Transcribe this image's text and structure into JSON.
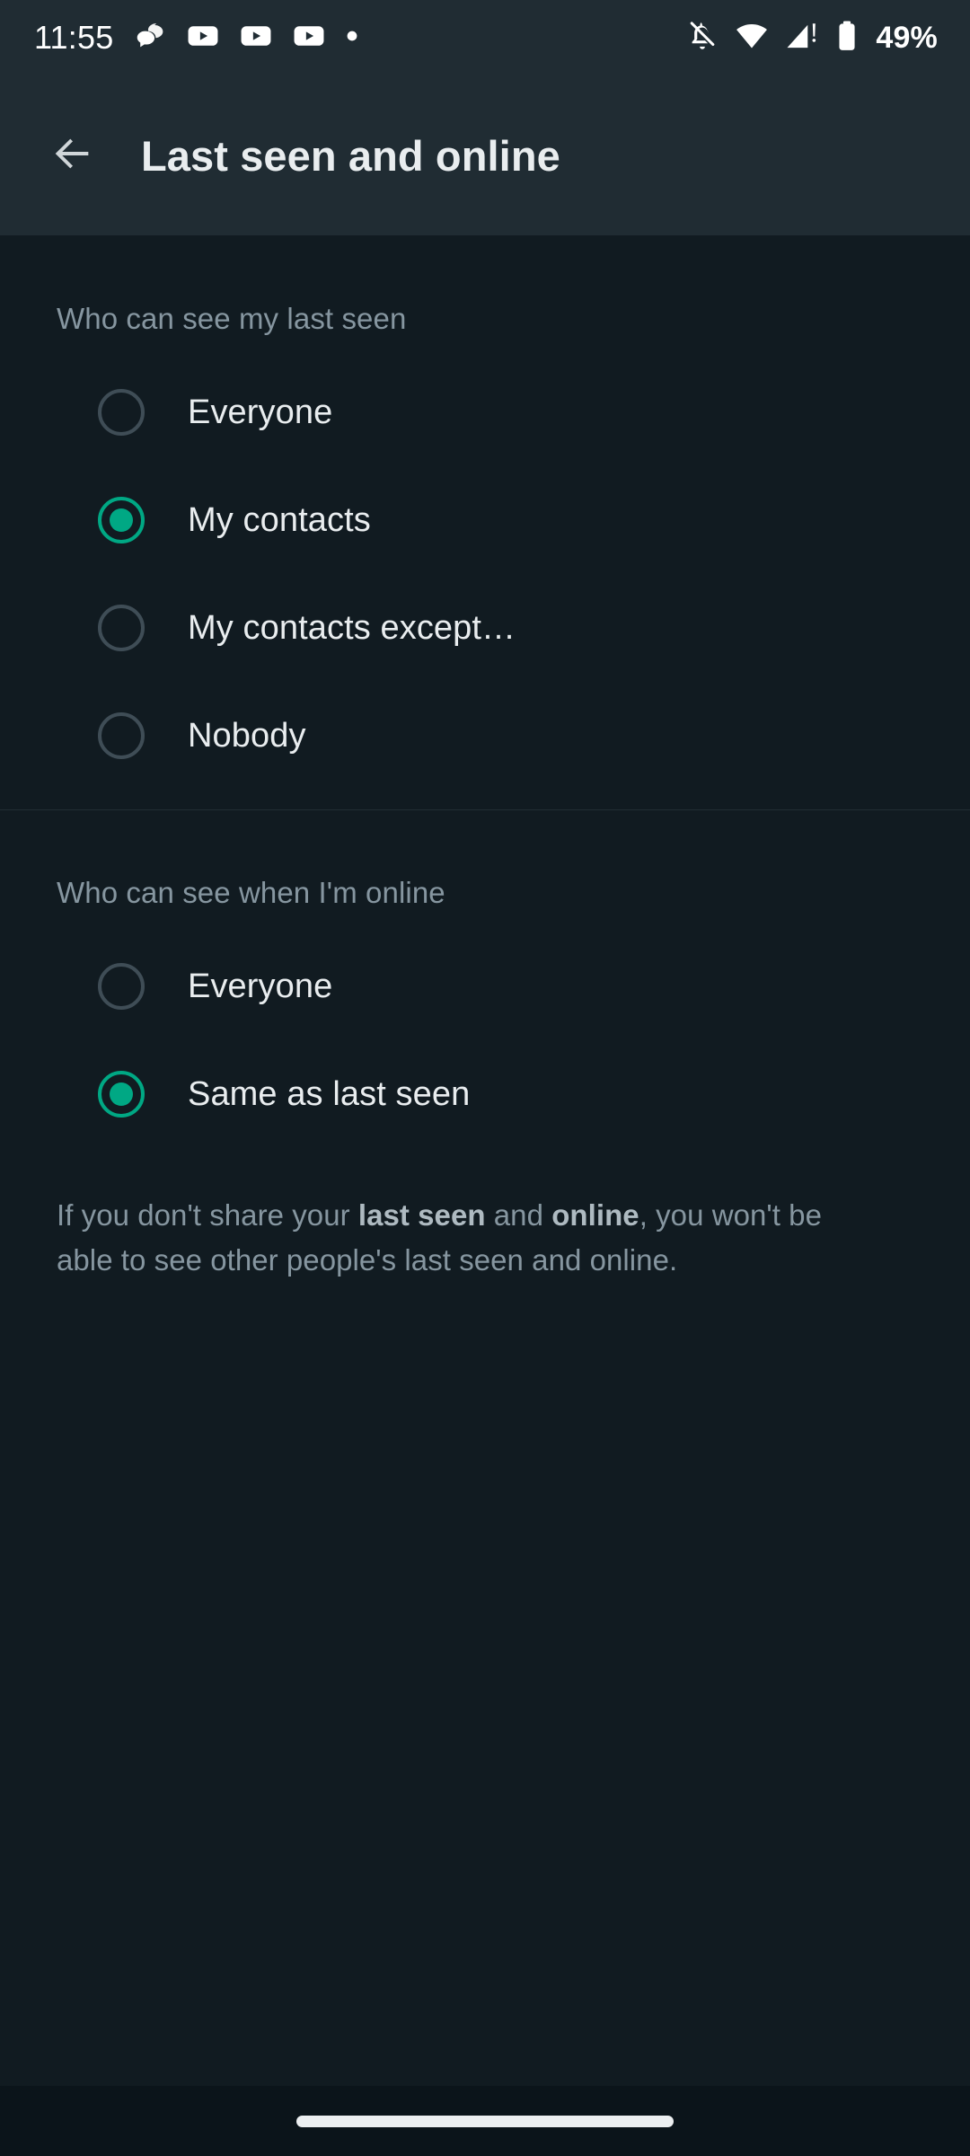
{
  "status_bar": {
    "time": "11:55",
    "left_icons": [
      {
        "name": "chat-bubbles-icon"
      },
      {
        "name": "youtube-play-icon"
      },
      {
        "name": "youtube-play-icon"
      },
      {
        "name": "youtube-play-icon"
      },
      {
        "name": "overflow-dot-icon"
      }
    ],
    "right_icons": [
      {
        "name": "notifications-off-icon"
      },
      {
        "name": "wifi-icon"
      },
      {
        "name": "cellular-signal-alert-icon"
      },
      {
        "name": "battery-icon"
      }
    ],
    "battery_percent": "49%"
  },
  "app_bar": {
    "back_icon": "arrow-left-icon",
    "title": "Last seen and online"
  },
  "sections": [
    {
      "header": "Who can see my last seen",
      "options": [
        {
          "label": "Everyone",
          "selected": false
        },
        {
          "label": "My contacts",
          "selected": true
        },
        {
          "label": "My contacts except…",
          "selected": false
        },
        {
          "label": "Nobody",
          "selected": false
        }
      ]
    },
    {
      "header": "Who can see when I'm online",
      "options": [
        {
          "label": "Everyone",
          "selected": false
        },
        {
          "label": "Same as last seen",
          "selected": true
        }
      ]
    }
  ],
  "footer": {
    "prefix": "If you don't share your ",
    "bold1": "last seen",
    "middle": " and ",
    "bold2": "online",
    "suffix": ", you won't be able to see other people's last seen and online."
  },
  "nav_bar": {
    "handle": "home-gesture-handle"
  },
  "colors": {
    "accent": "#00a884",
    "app_bar_bg": "#202c33",
    "body_bg": "#111b21",
    "nav_bg": "#0b141a",
    "primary_text": "#e9edef",
    "secondary_text": "#8696a0",
    "radio_unselected": "#3f4d56"
  }
}
